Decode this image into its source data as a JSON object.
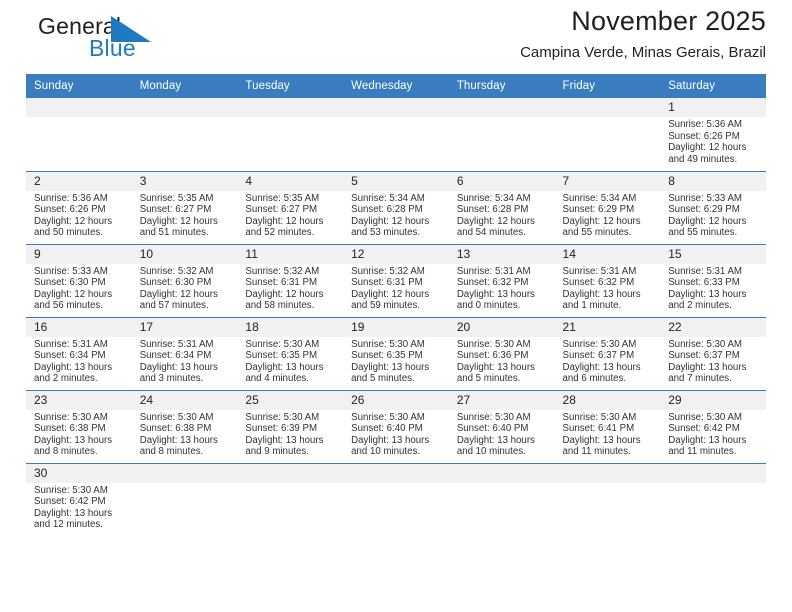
{
  "brand": {
    "name_line1": "General",
    "name_line2": "Blue",
    "mark_icon": "blue-triangle-icon",
    "accent_color": "#1f7ac1"
  },
  "header": {
    "title": "November 2025",
    "subtitle": "Campina Verde, Minas Gerais, Brazil"
  },
  "calendar": {
    "header_bg": "#3a7dbf",
    "daynum_bg": "#f1f1f1",
    "weekdays": [
      "Sunday",
      "Monday",
      "Tuesday",
      "Wednesday",
      "Thursday",
      "Friday",
      "Saturday"
    ],
    "weeks": [
      [
        {
          "day": "",
          "sunrise": "",
          "sunset": "",
          "daylight1": "",
          "daylight2": ""
        },
        {
          "day": "",
          "sunrise": "",
          "sunset": "",
          "daylight1": "",
          "daylight2": ""
        },
        {
          "day": "",
          "sunrise": "",
          "sunset": "",
          "daylight1": "",
          "daylight2": ""
        },
        {
          "day": "",
          "sunrise": "",
          "sunset": "",
          "daylight1": "",
          "daylight2": ""
        },
        {
          "day": "",
          "sunrise": "",
          "sunset": "",
          "daylight1": "",
          "daylight2": ""
        },
        {
          "day": "",
          "sunrise": "",
          "sunset": "",
          "daylight1": "",
          "daylight2": ""
        },
        {
          "day": "1",
          "sunrise": "Sunrise: 5:36 AM",
          "sunset": "Sunset: 6:26 PM",
          "daylight1": "Daylight: 12 hours",
          "daylight2": "and 49 minutes."
        }
      ],
      [
        {
          "day": "2",
          "sunrise": "Sunrise: 5:36 AM",
          "sunset": "Sunset: 6:26 PM",
          "daylight1": "Daylight: 12 hours",
          "daylight2": "and 50 minutes."
        },
        {
          "day": "3",
          "sunrise": "Sunrise: 5:35 AM",
          "sunset": "Sunset: 6:27 PM",
          "daylight1": "Daylight: 12 hours",
          "daylight2": "and 51 minutes."
        },
        {
          "day": "4",
          "sunrise": "Sunrise: 5:35 AM",
          "sunset": "Sunset: 6:27 PM",
          "daylight1": "Daylight: 12 hours",
          "daylight2": "and 52 minutes."
        },
        {
          "day": "5",
          "sunrise": "Sunrise: 5:34 AM",
          "sunset": "Sunset: 6:28 PM",
          "daylight1": "Daylight: 12 hours",
          "daylight2": "and 53 minutes."
        },
        {
          "day": "6",
          "sunrise": "Sunrise: 5:34 AM",
          "sunset": "Sunset: 6:28 PM",
          "daylight1": "Daylight: 12 hours",
          "daylight2": "and 54 minutes."
        },
        {
          "day": "7",
          "sunrise": "Sunrise: 5:34 AM",
          "sunset": "Sunset: 6:29 PM",
          "daylight1": "Daylight: 12 hours",
          "daylight2": "and 55 minutes."
        },
        {
          "day": "8",
          "sunrise": "Sunrise: 5:33 AM",
          "sunset": "Sunset: 6:29 PM",
          "daylight1": "Daylight: 12 hours",
          "daylight2": "and 55 minutes."
        }
      ],
      [
        {
          "day": "9",
          "sunrise": "Sunrise: 5:33 AM",
          "sunset": "Sunset: 6:30 PM",
          "daylight1": "Daylight: 12 hours",
          "daylight2": "and 56 minutes."
        },
        {
          "day": "10",
          "sunrise": "Sunrise: 5:32 AM",
          "sunset": "Sunset: 6:30 PM",
          "daylight1": "Daylight: 12 hours",
          "daylight2": "and 57 minutes."
        },
        {
          "day": "11",
          "sunrise": "Sunrise: 5:32 AM",
          "sunset": "Sunset: 6:31 PM",
          "daylight1": "Daylight: 12 hours",
          "daylight2": "and 58 minutes."
        },
        {
          "day": "12",
          "sunrise": "Sunrise: 5:32 AM",
          "sunset": "Sunset: 6:31 PM",
          "daylight1": "Daylight: 12 hours",
          "daylight2": "and 59 minutes."
        },
        {
          "day": "13",
          "sunrise": "Sunrise: 5:31 AM",
          "sunset": "Sunset: 6:32 PM",
          "daylight1": "Daylight: 13 hours",
          "daylight2": "and 0 minutes."
        },
        {
          "day": "14",
          "sunrise": "Sunrise: 5:31 AM",
          "sunset": "Sunset: 6:32 PM",
          "daylight1": "Daylight: 13 hours",
          "daylight2": "and 1 minute."
        },
        {
          "day": "15",
          "sunrise": "Sunrise: 5:31 AM",
          "sunset": "Sunset: 6:33 PM",
          "daylight1": "Daylight: 13 hours",
          "daylight2": "and 2 minutes."
        }
      ],
      [
        {
          "day": "16",
          "sunrise": "Sunrise: 5:31 AM",
          "sunset": "Sunset: 6:34 PM",
          "daylight1": "Daylight: 13 hours",
          "daylight2": "and 2 minutes."
        },
        {
          "day": "17",
          "sunrise": "Sunrise: 5:31 AM",
          "sunset": "Sunset: 6:34 PM",
          "daylight1": "Daylight: 13 hours",
          "daylight2": "and 3 minutes."
        },
        {
          "day": "18",
          "sunrise": "Sunrise: 5:30 AM",
          "sunset": "Sunset: 6:35 PM",
          "daylight1": "Daylight: 13 hours",
          "daylight2": "and 4 minutes."
        },
        {
          "day": "19",
          "sunrise": "Sunrise: 5:30 AM",
          "sunset": "Sunset: 6:35 PM",
          "daylight1": "Daylight: 13 hours",
          "daylight2": "and 5 minutes."
        },
        {
          "day": "20",
          "sunrise": "Sunrise: 5:30 AM",
          "sunset": "Sunset: 6:36 PM",
          "daylight1": "Daylight: 13 hours",
          "daylight2": "and 5 minutes."
        },
        {
          "day": "21",
          "sunrise": "Sunrise: 5:30 AM",
          "sunset": "Sunset: 6:37 PM",
          "daylight1": "Daylight: 13 hours",
          "daylight2": "and 6 minutes."
        },
        {
          "day": "22",
          "sunrise": "Sunrise: 5:30 AM",
          "sunset": "Sunset: 6:37 PM",
          "daylight1": "Daylight: 13 hours",
          "daylight2": "and 7 minutes."
        }
      ],
      [
        {
          "day": "23",
          "sunrise": "Sunrise: 5:30 AM",
          "sunset": "Sunset: 6:38 PM",
          "daylight1": "Daylight: 13 hours",
          "daylight2": "and 8 minutes."
        },
        {
          "day": "24",
          "sunrise": "Sunrise: 5:30 AM",
          "sunset": "Sunset: 6:38 PM",
          "daylight1": "Daylight: 13 hours",
          "daylight2": "and 8 minutes."
        },
        {
          "day": "25",
          "sunrise": "Sunrise: 5:30 AM",
          "sunset": "Sunset: 6:39 PM",
          "daylight1": "Daylight: 13 hours",
          "daylight2": "and 9 minutes."
        },
        {
          "day": "26",
          "sunrise": "Sunrise: 5:30 AM",
          "sunset": "Sunset: 6:40 PM",
          "daylight1": "Daylight: 13 hours",
          "daylight2": "and 10 minutes."
        },
        {
          "day": "27",
          "sunrise": "Sunrise: 5:30 AM",
          "sunset": "Sunset: 6:40 PM",
          "daylight1": "Daylight: 13 hours",
          "daylight2": "and 10 minutes."
        },
        {
          "day": "28",
          "sunrise": "Sunrise: 5:30 AM",
          "sunset": "Sunset: 6:41 PM",
          "daylight1": "Daylight: 13 hours",
          "daylight2": "and 11 minutes."
        },
        {
          "day": "29",
          "sunrise": "Sunrise: 5:30 AM",
          "sunset": "Sunset: 6:42 PM",
          "daylight1": "Daylight: 13 hours",
          "daylight2": "and 11 minutes."
        }
      ],
      [
        {
          "day": "30",
          "sunrise": "Sunrise: 5:30 AM",
          "sunset": "Sunset: 6:42 PM",
          "daylight1": "Daylight: 13 hours",
          "daylight2": "and 12 minutes."
        },
        {
          "day": "",
          "sunrise": "",
          "sunset": "",
          "daylight1": "",
          "daylight2": ""
        },
        {
          "day": "",
          "sunrise": "",
          "sunset": "",
          "daylight1": "",
          "daylight2": ""
        },
        {
          "day": "",
          "sunrise": "",
          "sunset": "",
          "daylight1": "",
          "daylight2": ""
        },
        {
          "day": "",
          "sunrise": "",
          "sunset": "",
          "daylight1": "",
          "daylight2": ""
        },
        {
          "day": "",
          "sunrise": "",
          "sunset": "",
          "daylight1": "",
          "daylight2": ""
        },
        {
          "day": "",
          "sunrise": "",
          "sunset": "",
          "daylight1": "",
          "daylight2": ""
        }
      ]
    ]
  }
}
